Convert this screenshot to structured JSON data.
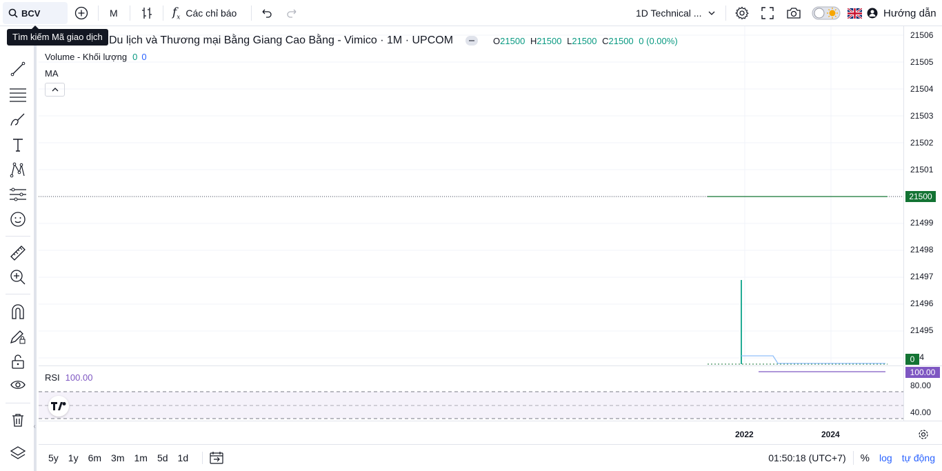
{
  "toolbar": {
    "symbol": "BCV",
    "interval": "M",
    "indicators_label": "Các chỉ báo",
    "layout_name": "1D Technical ...",
    "guide_label": "Hướng dẫn",
    "symbol_tooltip": "Tìm kiếm Mã giao dịch"
  },
  "legend": {
    "title": "Du lịch và Thương mại Bằng Giang Cao Bằng - Vimico · 1M · UPCOM",
    "o_label": "O",
    "o_value": "21500",
    "h_label": "H",
    "h_value": "21500",
    "l_label": "L",
    "l_value": "21500",
    "c_label": "C",
    "c_value": "21500",
    "change": "0 (0.00%)",
    "volume_label": "Volume - Khối lượng",
    "volume_v1": "0",
    "volume_v2": "0",
    "ma_label": "MA"
  },
  "price_scale": {
    "ticks": [
      "21506",
      "21505",
      "21504",
      "21503",
      "21502",
      "21501",
      "21499",
      "21498",
      "21497",
      "21496",
      "21495",
      "494"
    ],
    "last_price": "21500",
    "volume_badge": "0"
  },
  "rsi": {
    "label": "RSI",
    "value": "100.00",
    "badge": "100.00",
    "ticks": [
      "80.00",
      "40.00"
    ]
  },
  "time_scale": {
    "labels": [
      "2022",
      "2024"
    ]
  },
  "bottom": {
    "ranges": [
      "5y",
      "1y",
      "6m",
      "3m",
      "1m",
      "5d",
      "1d"
    ],
    "clock": "01:50:18 (UTC+7)",
    "percent": "%",
    "log": "log",
    "auto": "tự động"
  },
  "colors": {
    "green": "#089981",
    "up": "#22ab94",
    "rsi": "#7e57c2",
    "accent": "#2962ff"
  }
}
